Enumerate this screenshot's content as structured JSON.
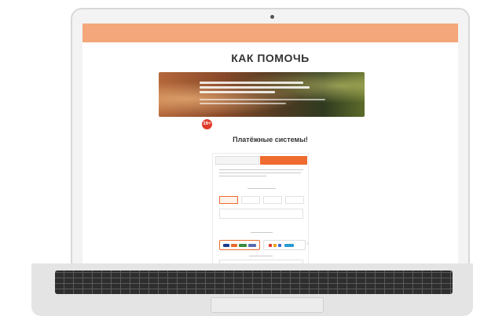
{
  "page": {
    "title": "КАК ПОМОЧЬ",
    "age_badge": "16+",
    "payment_title": "Платёжные системы!"
  },
  "payment_form": {
    "tabs": [
      "",
      ""
    ],
    "amounts": [
      "",
      "",
      "",
      ""
    ],
    "selected_amount_index": 0
  },
  "colors": {
    "accent": "#ef6b2f",
    "topbar": "#f4a77a",
    "badge": "#e03a2a"
  }
}
